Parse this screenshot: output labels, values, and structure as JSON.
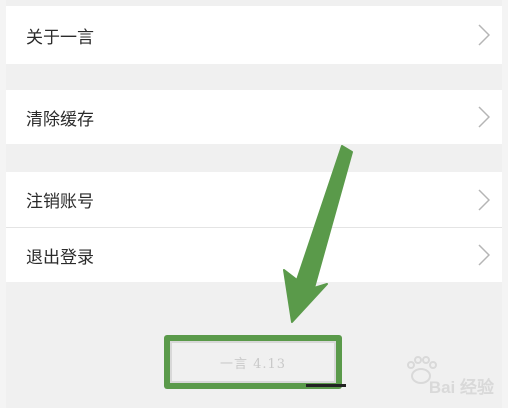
{
  "menu": {
    "items": [
      {
        "label": "关于一言"
      },
      {
        "label": "清除缓存"
      },
      {
        "label": "注销账号"
      },
      {
        "label": "退出登录"
      }
    ]
  },
  "version": {
    "text": "一言 4.13"
  },
  "watermark": {
    "text": "Bai  经验"
  },
  "colors": {
    "background": "#f4f4f4",
    "row": "#ffffff",
    "highlight": "#5a9a4a",
    "text": "#2b2b2b",
    "chevron": "#b5b5b5"
  },
  "icons": [
    "chevron-right-icon",
    "arrow-down-annotation",
    "baidu-paw-icon"
  ]
}
